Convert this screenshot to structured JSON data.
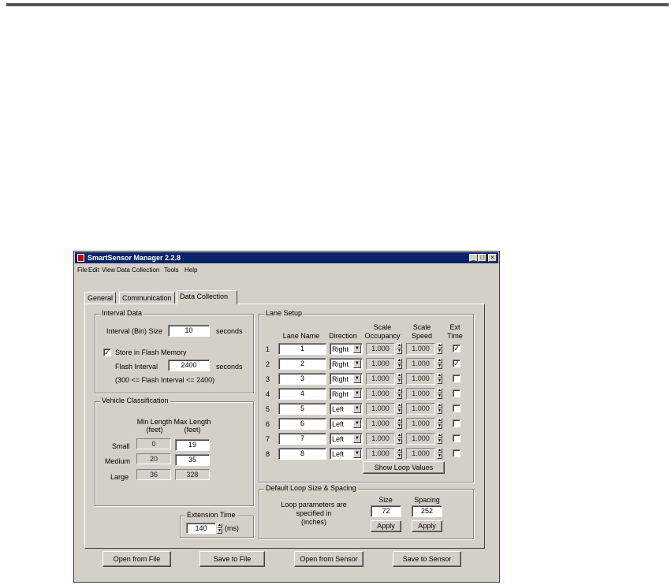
{
  "window": {
    "title": "SmartSensor Manager 2.2.8"
  },
  "menu": [
    "File",
    "Edit",
    "View",
    "Data Collection",
    "Tools",
    "Help"
  ],
  "tabs": [
    "General",
    "Communication",
    "Data Collection"
  ],
  "active_tab": "Data Collection",
  "interval": {
    "group_label": "Interval Data",
    "size_label": "Interval (Bin) Size",
    "size_value": "10",
    "size_unit": "seconds",
    "store_label": "Store in Flash Memory",
    "store_checked": true,
    "flash_label": "Flash Interval",
    "flash_value": "2400",
    "flash_unit": "seconds",
    "note": "(300 <= Flash Interval <= 2400)"
  },
  "vehicle": {
    "group_label": "Vehicle Classification",
    "min_header_1": "Min Length",
    "min_header_2": "(feet)",
    "max_header_1": "Max Length",
    "max_header_2": "(feet)",
    "rows": [
      {
        "label": "Small",
        "min": "0",
        "max": "19",
        "max_editable": true
      },
      {
        "label": "Medium",
        "min": "20",
        "max": "35",
        "max_editable": true
      },
      {
        "label": "Large",
        "min": "36",
        "max": "328",
        "max_editable": false
      }
    ]
  },
  "extension": {
    "label": "Extension Time",
    "value": "140",
    "unit": "(ms)"
  },
  "lanes": {
    "group_label": "Lane Setup",
    "headers": {
      "name": "Lane Name",
      "direction": "Direction",
      "occ_1": "Scale",
      "occ_2": "Occupancy",
      "speed_1": "Scale",
      "speed_2": "Speed",
      "ext_1": "Ext",
      "ext_2": "Time"
    },
    "rows": [
      {
        "num": "1",
        "name": "1",
        "direction": "Right",
        "occ": "1.000",
        "speed": "1.000",
        "ext": true
      },
      {
        "num": "2",
        "name": "2",
        "direction": "Right",
        "occ": "1.000",
        "speed": "1.000",
        "ext": true
      },
      {
        "num": "3",
        "name": "3",
        "direction": "Right",
        "occ": "1.000",
        "speed": "1.000",
        "ext": false
      },
      {
        "num": "4",
        "name": "4",
        "direction": "Right",
        "occ": "1.000",
        "speed": "1.000",
        "ext": false
      },
      {
        "num": "5",
        "name": "5",
        "direction": "Left",
        "occ": "1.000",
        "speed": "1.000",
        "ext": false
      },
      {
        "num": "6",
        "name": "6",
        "direction": "Left",
        "occ": "1.000",
        "speed": "1.000",
        "ext": false
      },
      {
        "num": "7",
        "name": "7",
        "direction": "Left",
        "occ": "1.000",
        "speed": "1.000",
        "ext": false
      },
      {
        "num": "8",
        "name": "8",
        "direction": "Left",
        "occ": "1.000",
        "speed": "1.000",
        "ext": false
      }
    ],
    "show_loop_label": "Show Loop Values"
  },
  "loop": {
    "group_label": "Default Loop Size & Spacing",
    "desc_1": "Loop parameters are",
    "desc_2": "specified in",
    "desc_3": "(inches)",
    "size_label": "Size",
    "size_value": "72",
    "spacing_label": "Spacing",
    "spacing_value": "252",
    "apply_label": "Apply"
  },
  "footer": {
    "open_file": "Open from File",
    "save_file": "Save to File",
    "open_sensor": "Open from Sensor",
    "save_sensor": "Save to Sensor"
  }
}
